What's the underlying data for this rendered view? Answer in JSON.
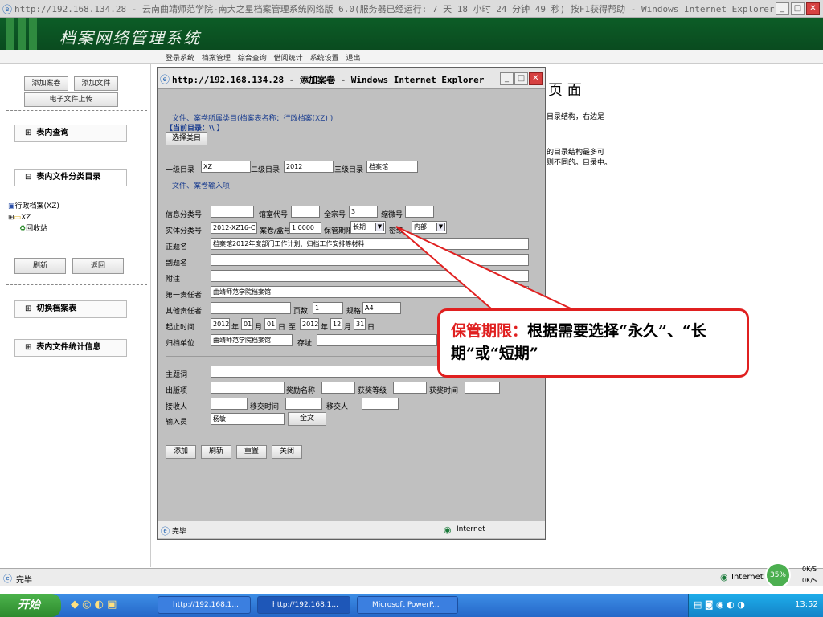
{
  "browser": {
    "title": "http://192.168.134.28 - 云南曲靖师范学院-南大之星档案管理系统网络版 6.0(服务器已经运行: 7 天 18 小时 24 分钟 49 秒) 按F1获得帮助 - Windows Internet Explorer",
    "status_text": "完毕",
    "zone": "Internet"
  },
  "app": {
    "brand": "档案网络管理系统",
    "nav": [
      "登录系统",
      "档案管理",
      "综合查询",
      "借阅统计",
      "系统设置",
      "退出"
    ]
  },
  "left": {
    "add_case": "添加案卷",
    "add_file": "添加文件",
    "e_upload": "电子文件上传",
    "query": "表内查询",
    "catalog": "表内文件分类目录",
    "tree": {
      "root": "行政档案(XZ)",
      "child": "XZ",
      "recycle": "回收站"
    },
    "refresh": "刷新",
    "back": "返回",
    "switch_table": "切换档案表",
    "stats": "表内文件统计信息"
  },
  "bg_right": {
    "heading": "页 面",
    "line1": "目录结构，右边是",
    "line2": "的目录结构最多可",
    "line3": "则不同的。目录中。"
  },
  "popup": {
    "title": "http://192.168.134.28 - 添加案卷 - Windows Internet Explorer",
    "class_line": "文件、案卷所属类目(档案表名称：行政档案(XZ) )",
    "current_dir": "【当前目录：\\\\ 】",
    "choose_class": "选择类目",
    "lvl1_label": "一级目录",
    "lvl1_value": "XZ",
    "lvl2_label": "二级目录",
    "lvl2_value": "2012",
    "lvl3_label": "三级目录",
    "lvl3_value": "档案馆",
    "input_section": "文件、案卷输入项",
    "info_class": "信息分类号",
    "room_code": "馆室代号",
    "fonds_no": "全宗号",
    "fonds_value": "3",
    "microfilm": "缩微号",
    "entity_class": "实体分类号",
    "entity_value": "2012-XZ16-C",
    "box_no": "案卷/盒号",
    "box_value": "1.0000",
    "retention": "保管期限",
    "retention_value": "长期",
    "secrecy": "密级",
    "secrecy_value": "内部",
    "title_label": "正题名",
    "title_value": "档案馆2012年度部门工作计划、归档工作安排等材料",
    "subtitle": "副题名",
    "note": "附注",
    "first_resp": "第一责任者",
    "first_resp_value": "曲靖师范学院档案馆",
    "other_resp": "其他责任者",
    "pages": "页数",
    "pages_value": "1",
    "spec": "规格",
    "spec_value": "A4",
    "period": "起止时间",
    "start_year": "2012",
    "start_month": "01",
    "start_day": "01",
    "to": "至",
    "end_year": "2012",
    "end_month": "12",
    "end_day": "31",
    "year": "年",
    "month": "月",
    "day": "日",
    "archive_unit": "归档单位",
    "archive_unit_value": "曲靖师范学院档案馆",
    "location": "存址",
    "subject": "主题词",
    "publish": "出版项",
    "award_name": "奖励名称",
    "award_level": "获奖等级",
    "award_time": "获奖时间",
    "receiver": "接收人",
    "transfer_time": "移交时间",
    "transferor": "移交人",
    "inputter": "输入员",
    "inputter_value": "杨敏",
    "fulltext": "全文",
    "btn_add": "添加",
    "btn_refresh": "刷新",
    "btn_reset": "重置",
    "btn_close": "关闭",
    "status": "完毕",
    "zone": "Internet"
  },
  "callout": {
    "key": "保管期限：",
    "text": "根据需要选择“永久”、“长期”或“短期”"
  },
  "taskbar": {
    "start": "开始",
    "tasks": [
      "http://192.168.1...",
      "http://192.168.1...",
      "Microsoft PowerP..."
    ],
    "clock": "13:52",
    "net_percent": "35%",
    "up_rate": "0K/S",
    "down_rate": "0K/S"
  },
  "colors": {
    "header_green": "#0c5d27",
    "callout_red": "#e02020",
    "taskbar_blue": "#2567c8"
  }
}
